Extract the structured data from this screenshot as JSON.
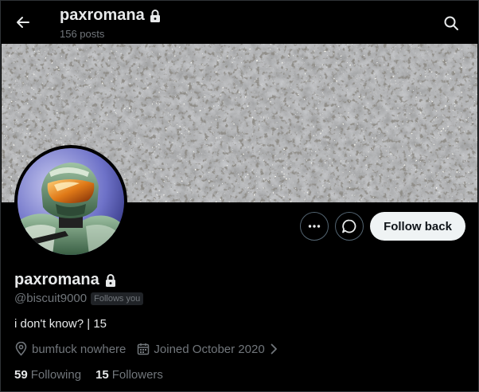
{
  "header": {
    "name": "paxromana",
    "posts": "156 posts"
  },
  "profile": {
    "display_name": "paxromana",
    "handle": "@biscuit9000",
    "follows_you": "Follows you",
    "bio": "i don't know? | 15",
    "location": "bumfuck nowhere",
    "joined": "Joined October 2020"
  },
  "actions": {
    "follow_back": "Follow back"
  },
  "stats": {
    "following_count": "59",
    "following_label": "Following",
    "followers_count": "15",
    "followers_label": "Followers"
  },
  "icons": {
    "back": "arrow-left-icon",
    "search": "search-icon",
    "lock": "lock-icon",
    "more": "more-horizontal-icon",
    "message": "message-bubble-icon",
    "location": "location-pin-icon",
    "calendar": "calendar-icon",
    "chevron": "chevron-right-icon"
  },
  "colors": {
    "background": "#000000",
    "text_primary": "#e7e9ea",
    "text_secondary": "#71767b",
    "button_light": "#eff3f4",
    "border": "#536471"
  }
}
